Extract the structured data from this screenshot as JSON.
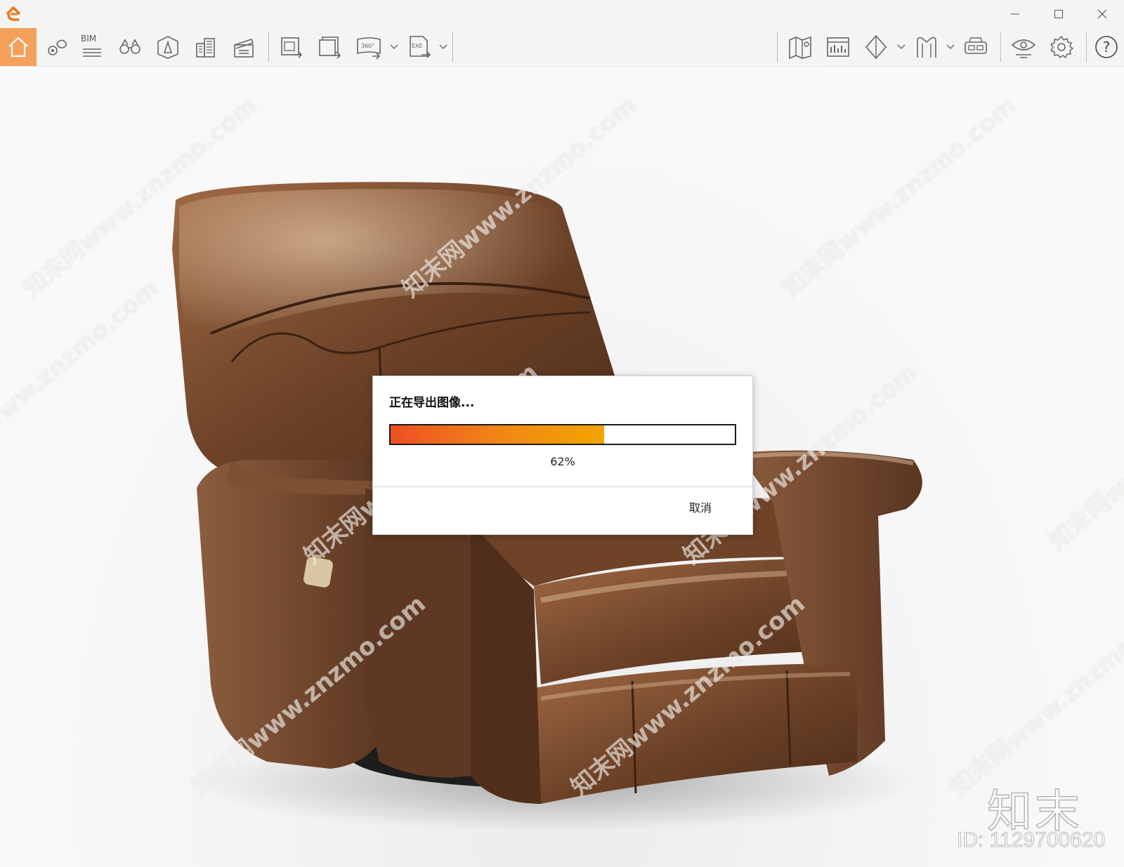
{
  "window": {
    "min_glyph": "—",
    "max_glyph": "☐",
    "close_glyph": "✕"
  },
  "toolbar": {
    "bim_label": "BIM",
    "left_tools": [
      "home-icon",
      "location-pin-icon",
      "bim-icon",
      "binoculars-icon",
      "cube-face-icon",
      "buildings-icon",
      "clapperboard-icon"
    ],
    "export_tools": [
      "export-image-icon",
      "batch-export-icon",
      "export-360-icon",
      "export-exe-icon"
    ],
    "export_360_label": "360°",
    "export_exe_label": "EXE",
    "right_tools": [
      "map-icon",
      "dashboard-icon",
      "section-cube-icon",
      "bookmark-icon",
      "vr-headset-icon",
      "eye-settings-icon",
      "gear-icon",
      "help-icon"
    ],
    "help_glyph": "?"
  },
  "dialog": {
    "title": "正在导出图像...",
    "progress_percent": 62,
    "progress_text": "62%",
    "cancel_label": "取消"
  },
  "watermark": {
    "text": "知末网www.znzmo.com",
    "brand": "知末",
    "id_text": "ID: 1129700620"
  },
  "colors": {
    "accent": "#f5a15c",
    "brand_orange": "#e8781e",
    "progress_start": "#ee4f24",
    "progress_end": "#f2a400"
  }
}
